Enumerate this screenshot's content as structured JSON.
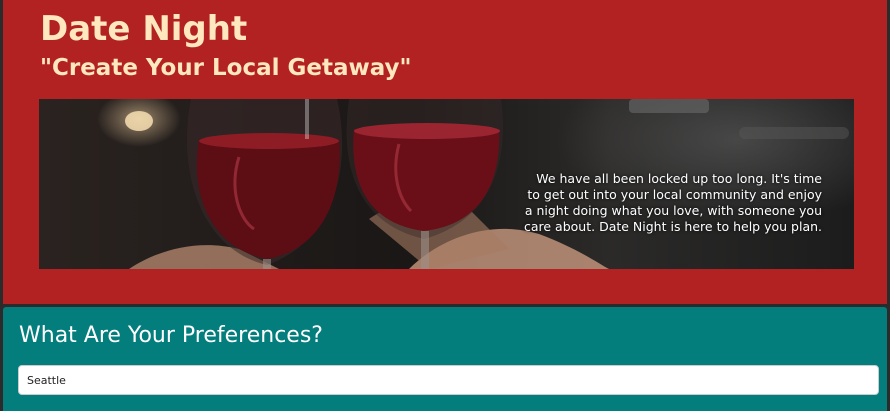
{
  "header": {
    "title": "Date Night",
    "subtitle": "\"Create Your Local Getaway\""
  },
  "banner": {
    "image": "wine-glasses-toast-photo",
    "text": "We have all been locked up too long. It's time to get out into your local community and enjoy a night doing what you love, with someone you care about. Date Night is here to help you plan."
  },
  "preferences": {
    "title": "What Are Your Preferences?",
    "location_value": "Seattle"
  },
  "colors": {
    "header_bg": "#b22222",
    "title_text": "#ffe7bf",
    "preferences_bg": "#047d7d"
  }
}
